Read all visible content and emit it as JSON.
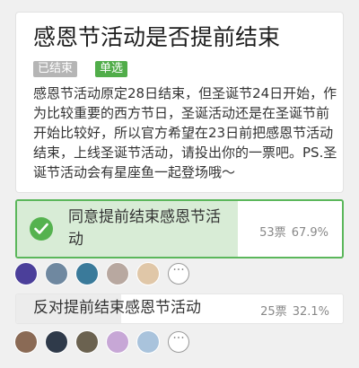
{
  "poll": {
    "title": "感恩节活动是否提前结束",
    "status_badge": "已结束",
    "type_badge": "单选",
    "description": "感恩节活动原定28日结束，但圣诞节24日开始，作为比较重要的西方节日，圣诞活动还是在圣诞节前开始比较好，所以官方希望在23日前把感恩节活动结束，上线圣诞节活动，请投出你的一票吧。PS.圣诞节活动会有星座鱼一起登场哦～"
  },
  "options": [
    {
      "label": "同意提前结束感恩节活动",
      "votes": "53票",
      "percent": "67.9%",
      "fraction": 0.679,
      "selected": true
    },
    {
      "label": "反对提前结束感恩节活动",
      "votes": "25票",
      "percent": "32.1%",
      "fraction": 0.321,
      "selected": false
    }
  ],
  "voters": {
    "more_icon": "more-icon",
    "row1": [
      {
        "icon": "avatar",
        "color": "#4b3f9a"
      },
      {
        "icon": "avatar",
        "color": "#6f88a0"
      },
      {
        "icon": "avatar",
        "color": "#3a7a9a"
      },
      {
        "icon": "avatar",
        "color": "#b8a8a0"
      },
      {
        "icon": "avatar",
        "color": "#e0c7a8"
      }
    ],
    "row2": [
      {
        "icon": "avatar",
        "color": "#8a6a55"
      },
      {
        "icon": "avatar",
        "color": "#2f3a4a"
      },
      {
        "icon": "avatar",
        "color": "#6b6250"
      },
      {
        "icon": "avatar",
        "color": "#c7a7d6"
      },
      {
        "icon": "avatar",
        "color": "#a9c3dc"
      }
    ]
  },
  "colors": {
    "accent": "#51ad4a",
    "selected_fill": "#d8ecd6",
    "unselected_fill": "#ececec",
    "ended_badge": "#b5b5b5"
  }
}
